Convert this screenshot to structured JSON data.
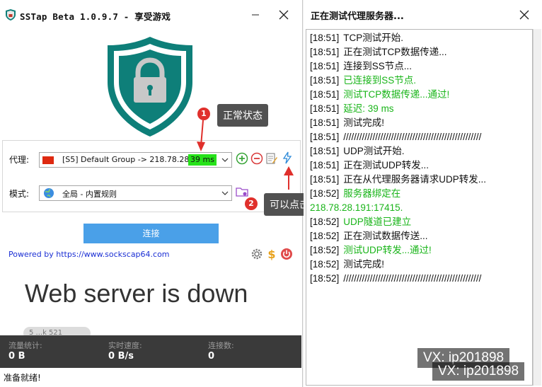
{
  "left_window": {
    "title": "SSTap Beta 1.0.9.7 - 享受游戏",
    "proxy_label": "代理:",
    "proxy_value": "[S5] Default Group -> 218.78.28...",
    "ping": "39 ms",
    "mode_label": "模式:",
    "mode_value": "全局 - 内置规则",
    "connect_label": "连接",
    "powered_by": "Powered by https://www.sockscap64.com",
    "web_message": "Web server is down",
    "ghost_text": "5   ...k 521",
    "stats": [
      {
        "label": "流量统计:",
        "value": "0 B"
      },
      {
        "label": "实时速度:",
        "value": "0 B/s"
      },
      {
        "label": "连接数:",
        "value": "0"
      }
    ],
    "status": "准备就绪!"
  },
  "annotations": [
    {
      "num": "1",
      "text": "正常状态"
    },
    {
      "num": "2",
      "text": "可以点击测试"
    }
  ],
  "right_window": {
    "title": "正在测试代理服务器...",
    "log": [
      {
        "time": "[18:51]",
        "text": "TCP测试开始.",
        "green": false
      },
      {
        "time": "[18:51]",
        "text": "正在测试TCP数据传递...",
        "green": false
      },
      {
        "time": "[18:51]",
        "text": "连接到SS节点...",
        "green": false
      },
      {
        "time": "[18:51]",
        "text": "已连接到SS节点.",
        "green": true
      },
      {
        "time": "[18:51]",
        "text": "测试TCP数据传递...通过!",
        "green": true
      },
      {
        "time": "[18:51]",
        "text": "延迟: 39 ms",
        "green": true
      },
      {
        "time": "[18:51]",
        "text": "测试完成!",
        "green": false
      },
      {
        "time": "[18:51]",
        "text": "////////////////////////////////////////////////////",
        "green": false
      },
      {
        "time": "[18:51]",
        "text": "UDP测试开始.",
        "green": false
      },
      {
        "time": "[18:51]",
        "text": "正在测试UDP转发...",
        "green": false
      },
      {
        "time": "[18:51]",
        "text": "正在从代理服务器请求UDP转发...",
        "green": false
      },
      {
        "time": "[18:52]",
        "text": "服务器绑定在",
        "green": true
      },
      {
        "time": "",
        "text": "218.78.28.191:17415.",
        "green": true
      },
      {
        "time": "[18:52]",
        "text": "UDP隧道已建立",
        "green": true
      },
      {
        "time": "[18:52]",
        "text": "正在测试数据传送...",
        "green": false
      },
      {
        "time": "[18:52]",
        "text": "测试UDP转发...通过!",
        "green": true
      },
      {
        "time": "[18:52]",
        "text": "测试完成!",
        "green": false
      },
      {
        "time": "[18:52]",
        "text": "////////////////////////////////////////////////////",
        "green": false
      }
    ]
  },
  "watermark": "VX: ip201898",
  "colors": {
    "accent": "#4aa0e8",
    "log_green": "#1ab51a",
    "ping_green": "#27e21a",
    "shield_teal": "#0e7f79",
    "stats_bg": "#3a3a3a"
  }
}
